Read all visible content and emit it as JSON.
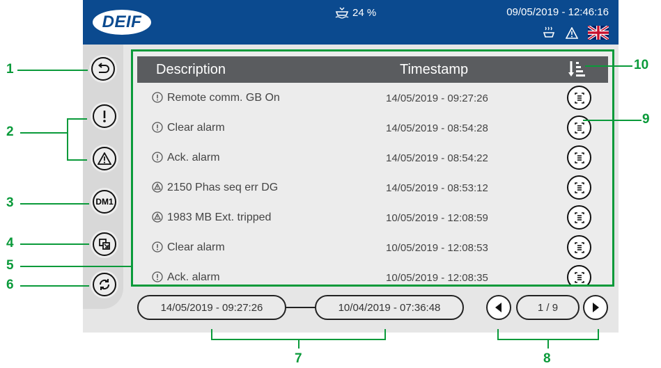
{
  "header": {
    "logo": "DEIF",
    "fuel_level": "24 %",
    "datetime": "09/05/2019 - 12:46:16",
    "icons": [
      "fuel-icon",
      "heater-icon",
      "warning-icon",
      "uk-flag-icon"
    ]
  },
  "sidebar": {
    "items": [
      {
        "name": "back",
        "icon": "back-arrow-icon"
      },
      {
        "name": "alarm-filter",
        "icon": "exclamation-icon"
      },
      {
        "name": "warning-filter",
        "icon": "warning-icon"
      },
      {
        "name": "dm1",
        "label": "DM1"
      },
      {
        "name": "zoom",
        "icon": "zoom-window-icon"
      },
      {
        "name": "refresh",
        "icon": "refresh-icon"
      }
    ]
  },
  "table": {
    "columns": [
      "Description",
      "Timestamp"
    ],
    "rows": [
      {
        "type": "info",
        "description": "Remote comm. GB On",
        "timestamp": "14/05/2019 - 09:27:26"
      },
      {
        "type": "info",
        "description": "Clear alarm",
        "timestamp": "14/05/2019 - 08:54:28"
      },
      {
        "type": "info",
        "description": "Ack. alarm",
        "timestamp": "14/05/2019 - 08:54:22"
      },
      {
        "type": "warning",
        "description": "2150 Phas seq err DG",
        "timestamp": "14/05/2019 - 08:53:12"
      },
      {
        "type": "warning",
        "description": "1983 MB Ext. tripped",
        "timestamp": "10/05/2019 - 12:08:59"
      },
      {
        "type": "info",
        "description": "Clear alarm",
        "timestamp": "10/05/2019 - 12:08:53"
      },
      {
        "type": "info",
        "description": "Ack. alarm",
        "timestamp": "10/05/2019 - 12:08:35"
      }
    ]
  },
  "footer": {
    "from_date": "14/05/2019 - 09:27:26",
    "to_date": "10/04/2019 - 07:36:48",
    "page": "1 / 9"
  },
  "callouts": [
    "1",
    "2",
    "3",
    "4",
    "5",
    "6",
    "7",
    "8",
    "9",
    "10"
  ],
  "colors": {
    "header": "#0b4a8f",
    "accent": "#0a9a3a",
    "table_header": "#5a5c5f"
  }
}
